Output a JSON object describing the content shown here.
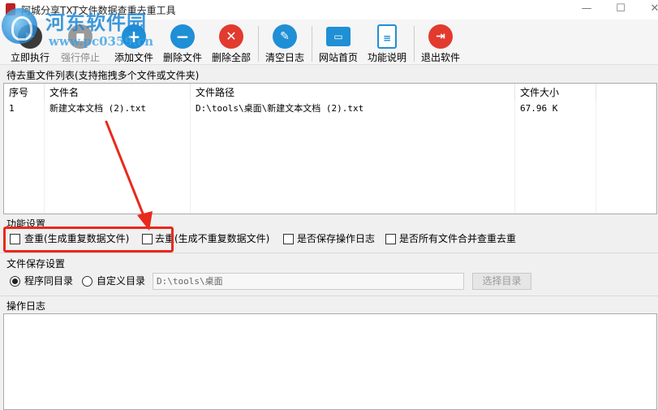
{
  "window": {
    "title": "阿城分享TXT文件数据查重去重工具",
    "minimize": "—",
    "maximize": "☐",
    "close": "✕"
  },
  "watermark": {
    "name": "河东软件园",
    "url": "www.pc0359.cn"
  },
  "toolbar": {
    "buttons": [
      {
        "label": "立即执行",
        "icon": "play-icon",
        "color": "#3a3a3a",
        "enabled": true
      },
      {
        "label": "强行停止",
        "icon": "stop-icon",
        "color": "#9a9a9a",
        "enabled": false
      },
      {
        "label": "添加文件",
        "icon": "plus-icon",
        "color": "#1f8fd6",
        "enabled": true
      },
      {
        "label": "删除文件",
        "icon": "minus-icon",
        "color": "#1f8fd6",
        "enabled": true
      },
      {
        "label": "删除全部",
        "icon": "x-icon",
        "color": "#e23a2e",
        "enabled": true
      },
      {
        "label": "清空日志",
        "icon": "broom-icon",
        "color": "#1f8fd6",
        "enabled": true
      },
      {
        "label": "网站首页",
        "icon": "monitor-icon",
        "color": "#1f8fd6",
        "enabled": true
      },
      {
        "label": "功能说明",
        "icon": "document-icon",
        "color": "#1f8fd6",
        "enabled": true
      },
      {
        "label": "退出软件",
        "icon": "exit-icon",
        "color": "#e23a2e",
        "enabled": true
      }
    ]
  },
  "file_list": {
    "label": "待去重文件列表(支持拖拽多个文件或文件夹)",
    "columns": [
      "序号",
      "文件名",
      "文件路径",
      "文件大小"
    ],
    "rows": [
      {
        "index": "1",
        "name": "新建文本文档 (2).txt",
        "path": "D:\\tools\\桌面\\新建文本文档 (2).txt",
        "size": "67.96 K"
      }
    ]
  },
  "functions": {
    "label": "功能设置",
    "options": [
      {
        "label": "查重(生成重复数据文件)",
        "checked": false
      },
      {
        "label": "去重(生成不重复数据文件)",
        "checked": false
      },
      {
        "label": "是否保存操作日志",
        "checked": false
      },
      {
        "label": "是否所有文件合并查重去重",
        "checked": false
      }
    ]
  },
  "save": {
    "label": "文件保存设置",
    "option_same": "程序同目录",
    "option_custom": "自定义目录",
    "selected": "程序同目录",
    "path": "D:\\tools\\桌面",
    "select_button": "选择目录"
  },
  "log": {
    "label": "操作日志",
    "content": ""
  },
  "annotation": {
    "color": "#e8291c"
  }
}
